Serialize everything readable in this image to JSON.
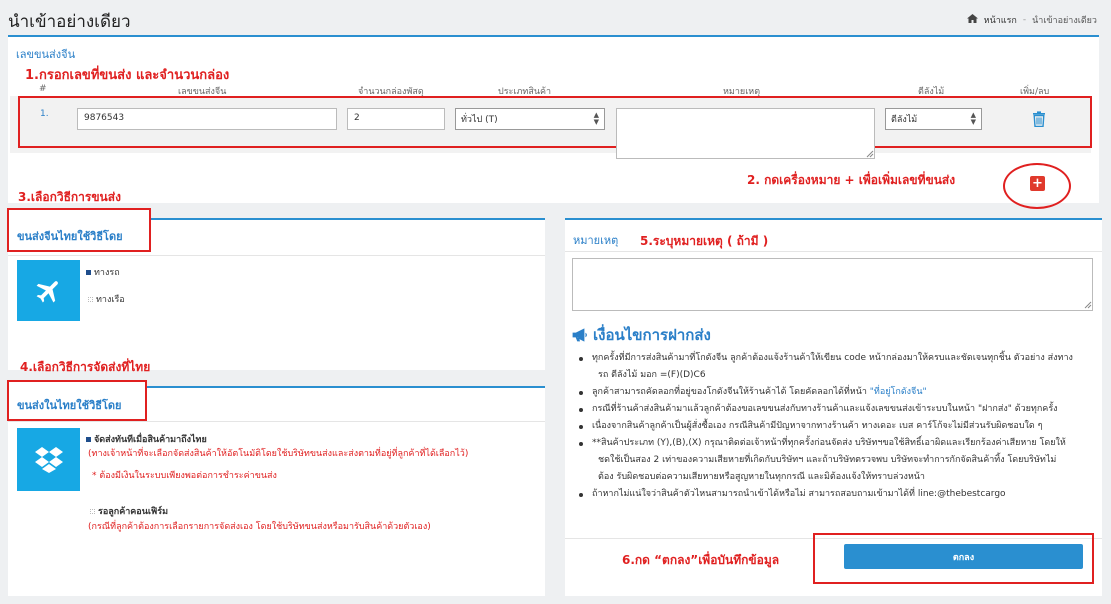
{
  "page": {
    "title": "นำเข้าอย่างเดียว"
  },
  "breadcrumb": {
    "home": "หน้าแรก",
    "sep": "-",
    "current": "นำเข้าอย่างเดียว"
  },
  "tracking": {
    "panel_title": "เลขขนส่งจีน",
    "step1": "1.กรอกเลขที่ขนส่ง และจำนวนกล่อง",
    "columns": [
      "#",
      "เลขขนส่งจีน",
      "จำนวนกล่องพัสดุ",
      "ประเภทสินค้า",
      "หมายเหตุ",
      "ตีลังไม้",
      "เพิ่ม/ลบ"
    ],
    "row": {
      "index": "1.",
      "tracking_no": "9876543",
      "boxes": "2",
      "type": "ทั่วไป (T)",
      "note": "",
      "crate": "ตีลังไม้"
    },
    "step2": "2. กดเครื่องหมาย + เพื่อเพิ่มเลขที่ขนส่ง"
  },
  "china_shipping": {
    "step3": "3.เลือกวิธีการขนส่ง",
    "title": "ขนส่งจีนไทยใช้วิธีโดย",
    "opt1": "ทางรถ",
    "opt2": "ทางเรือ"
  },
  "thai_shipping": {
    "step4": "4.เลือกวิธีการจัดส่งที่ไทย",
    "title": "ขนส่งในไทยใช้วิธีโดย",
    "opt1": "จัดส่งทันทีเมื่อสินค้ามาถึงไทย",
    "opt1_note1": "(ทางเจ้าหน้าที่จะเลือกจัดส่งสินค้าให้อัตโนมัติโดยใช้บริษัทขนส่งและส่งตามที่อยู่ที่ลูกค้าที่ได้เลือกไว้)",
    "opt1_note2": "* ต้องมีเงินในระบบเพียงพอต่อการชำระค่าขนส่ง",
    "opt2": "รอลูกค้าคอนเฟิร์ม",
    "opt2_note": "(กรณีที่ลูกค้าต้องการเลือกรายการจัดส่งเอง โดยใช้บริษัทขนส่งหรือมารับสินค้าด้วยตัวเอง)"
  },
  "remark": {
    "title": "หมายเหตุ",
    "step5": "5.ระบุหมายเหตุ ( ถ้ามี )",
    "value": ""
  },
  "conditions": {
    "title": "เงื่อนไขการฝากส่ง",
    "items": [
      "ทุกครั้งที่มีการส่งสินค้ามาที่โกดังจีน ลูกค้าต้องแจ้งร้านค้าให้เขียน code หน้ากล่องมาให้ครบและชัดเจนทุกชิ้น ตัวอย่าง ส่งทาง",
      "รถ ตีลังไม้ มอก =(F)(D)C6",
      "ลูกค้าสามารถคัดลอกที่อยู่ของโกดังจีนให้ร้านค้าได้ โดยคัดลอกได้ที่หน้า",
      "\"ที่อยู่โกดังจีน\"",
      "กรณีที่ร้านค้าส่งสินค้ามาแล้วลูกค้าต้องขอเลขขนส่งกับทางร้านค้าและแจ้งเลขขนส่งเข้าระบบในหน้า \"ฝากส่ง\" ด้วยทุกครั้ง",
      "เนื่องจากสินค้าลูกค้าเป็นผู้สั่งซื้อเอง กรณีสินค้ามีปัญหาจากทางร้านค้า ทางเดอะ เบส คาร์โก้จะไม่มีส่วนรับผิดชอบใด ๆ",
      "**สินค้าประเภท (Y),(B),(X) กรุณาติดต่อเจ้าหน้าที่ทุกครั้งก่อนจัดส่ง บริษัทฯขอใช้สิทธิ์เอาผิดและเรียกร้องค่าเสียหาย โดยให้",
      "ชดใช้เป็นสอง 2 เท่าของความเสียหายที่เกิดกับบริษัทฯ และถ้าบริษัทตรวจพบ บริษัทจะทำการกักจัดสินค้าทิ้ง โดยบริษัทไม่",
      "ต้อง รับผิดชอบต่อความเสียหายหรือสูญหายในทุกกรณี และมิต้องแจ้งให้ทราบล่วงหน้า",
      "ถ้าหากไม่แน่ใจว่าสินค้าตัวไหนสามารถนำเข้าได้หรือไม่ สามารถสอบถามเข้ามาได้ที่ line:@thebestcargo"
    ]
  },
  "submit": {
    "step6": "6.กด “ตกลง”เพื่อบันทึกข้อมูล",
    "label": "ตกลง"
  },
  "colors": {
    "accent": "#2a8fd0",
    "annotation": "#e02020",
    "icon_bg": "#17a8e4"
  }
}
